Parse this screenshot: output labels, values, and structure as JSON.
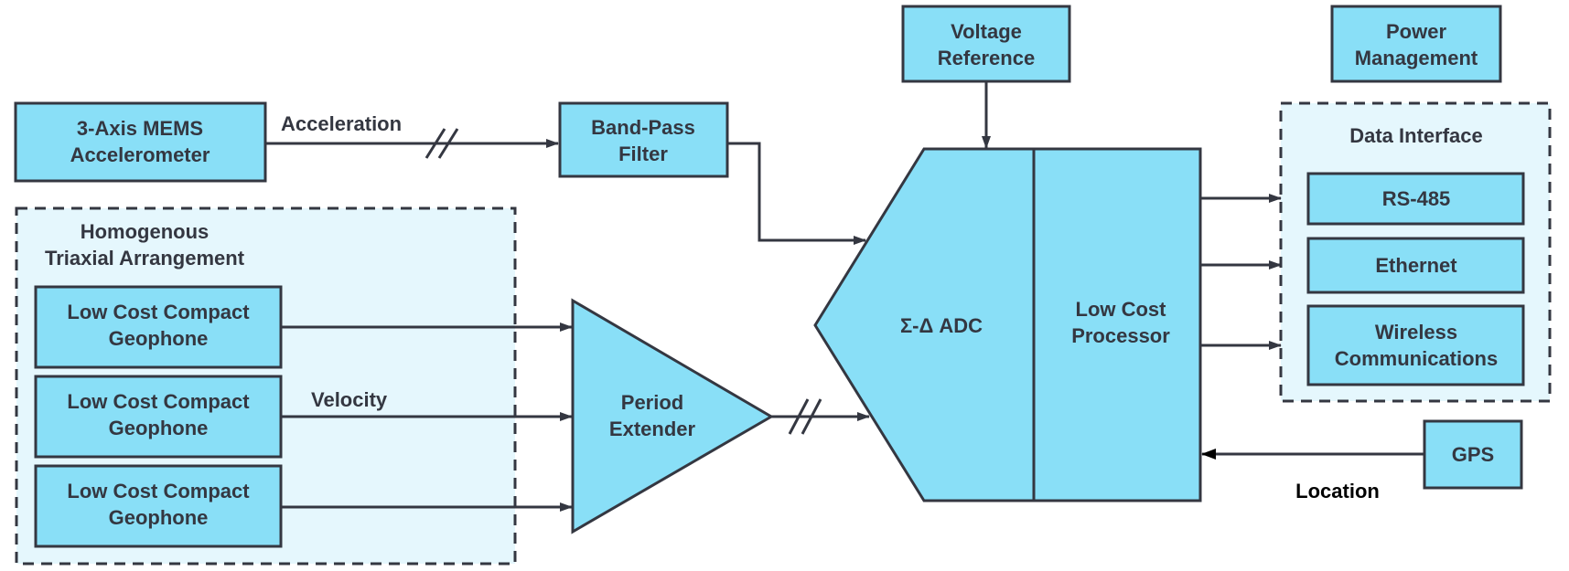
{
  "colors": {
    "block_fill": "#89dff7",
    "group_fill": "#e5f7fd",
    "stroke": "#343741",
    "text": "#343741",
    "background": "#ffffff"
  },
  "blocks": {
    "accelerometer": [
      "3-Axis MEMS",
      "Accelerometer"
    ],
    "band_pass_filter": [
      "Band-Pass",
      "Filter"
    ],
    "voltage_reference": [
      "Voltage",
      "Reference"
    ],
    "power_management": [
      "Power",
      "Management"
    ],
    "geophones": [
      [
        "Low Cost Compact",
        "Geophone"
      ],
      [
        "Low Cost Compact",
        "Geophone"
      ],
      [
        "Low Cost Compact",
        "Geophone"
      ]
    ],
    "period_extender": [
      "Period",
      "Extender"
    ],
    "adc": "Σ-Δ ADC",
    "processor": [
      "Low Cost",
      "Processor"
    ],
    "rs485": "RS-485",
    "ethernet": "Ethernet",
    "wireless": [
      "Wireless",
      "Communications"
    ],
    "gps": "GPS"
  },
  "groups": {
    "triaxial": [
      "Homogenous",
      "Triaxial Arrangement"
    ],
    "data_interface": "Data Interface"
  },
  "signals": {
    "acceleration": "Acceleration",
    "velocity": "Velocity",
    "location": "Location"
  }
}
